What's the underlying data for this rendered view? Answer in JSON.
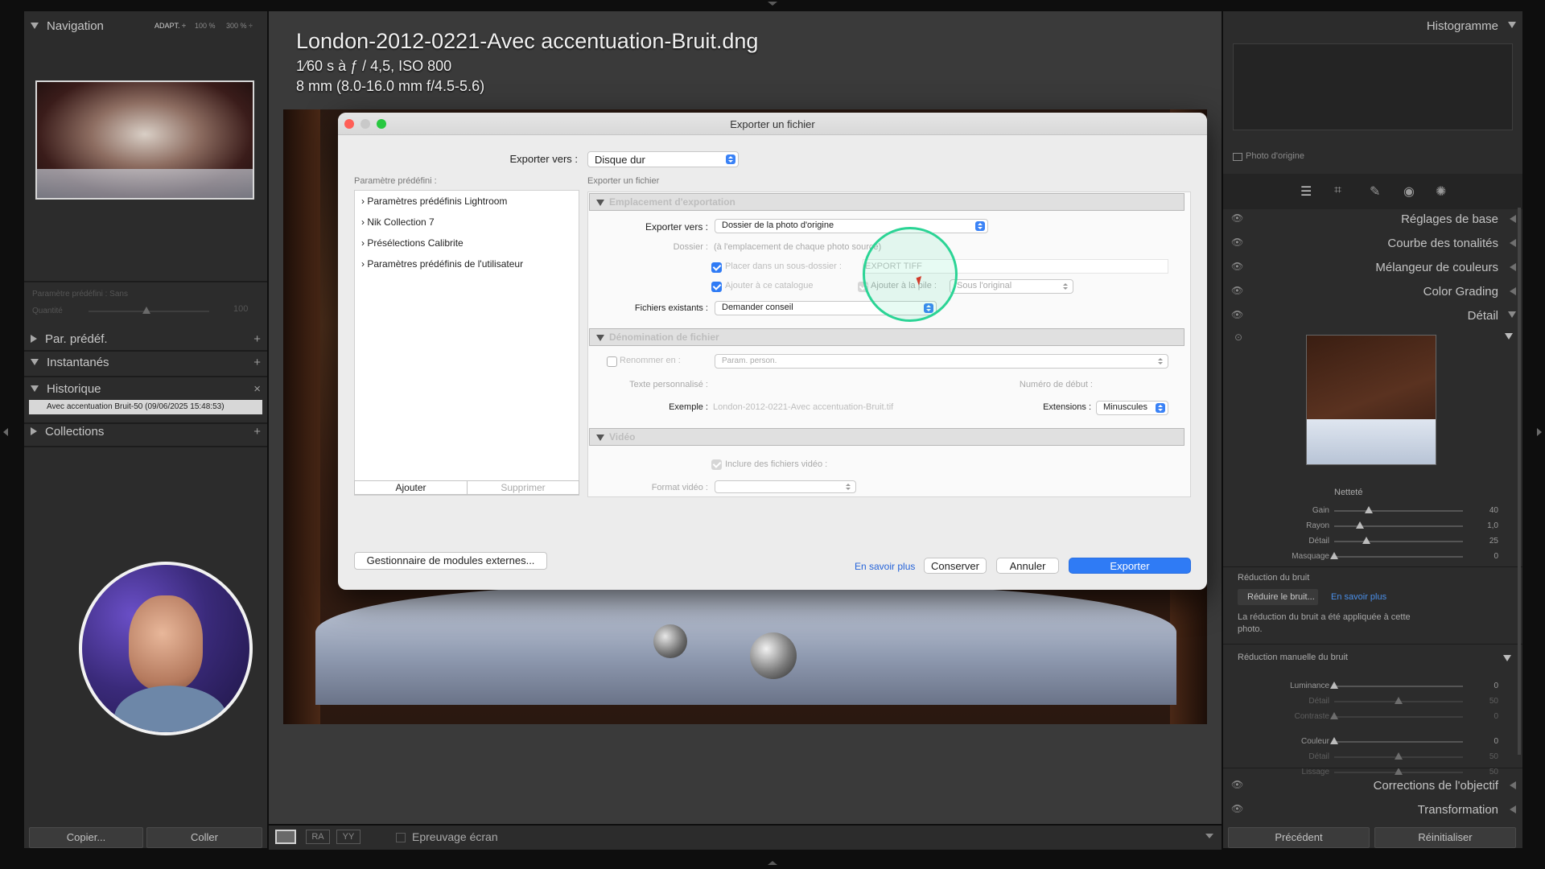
{
  "left": {
    "navigator": {
      "title": "Navigation",
      "zoom_options": [
        "ADAPT. ÷",
        "100 %",
        "300 % ÷"
      ]
    },
    "preset_area": {
      "preset_label": "Paramètre prédéfini : Sans",
      "quantity_label": "Quantité",
      "quantity_value": "100"
    },
    "sections": [
      {
        "label": "Par. prédéf."
      },
      {
        "label": "Instantanés"
      },
      {
        "label": "Historique"
      },
      {
        "label": "Collections"
      }
    ],
    "history_item": "Avec accentuation Bruit-50 (09/06/2025 15:48:53)",
    "copy_button": "Copier...",
    "paste_button": "Coller"
  },
  "photo_info": {
    "filename": "London-2012-0221-Avec accentuation-Bruit.dng",
    "exposure_fraction": "1⁄60",
    "exposure_rest": "s à ƒ / 4,5, ISO 800",
    "lens": "8 mm (8.0-16.0 mm f/4.5-5.6)"
  },
  "toolbar": {
    "view_modes": [
      "RA",
      "YY"
    ],
    "soft_proof_label": "Epreuvage écran"
  },
  "right": {
    "histogram_title": "Histogramme",
    "original_photo_label": "Photo d'origine",
    "panels": [
      "Réglages de base",
      "Courbe des tonalités",
      "Mélangeur de couleurs",
      "Color Grading",
      "Détail"
    ],
    "sharpening": {
      "title": "Netteté",
      "sliders": [
        {
          "name": "Gain",
          "value": "40",
          "pos": 0.27
        },
        {
          "name": "Rayon",
          "value": "1,0",
          "pos": 0.2
        },
        {
          "name": "Détail",
          "value": "25",
          "pos": 0.25
        },
        {
          "name": "Masquage",
          "value": "0",
          "pos": 0.0
        }
      ]
    },
    "noise_reduction": {
      "title": "Réduction du bruit",
      "button": "Réduire le bruit...",
      "link": "En savoir plus",
      "info": "La réduction du bruit a été appliquée à cette photo.",
      "manual_title": "Réduction manuelle du bruit",
      "sliders": [
        {
          "name": "Luminance",
          "value": "0",
          "pos": 0.0,
          "dim": false
        },
        {
          "name": "Détail",
          "value": "50",
          "pos": 0.5,
          "dim": true
        },
        {
          "name": "Contraste",
          "value": "0",
          "pos": 0.0,
          "dim": true
        },
        {
          "name": "Couleur",
          "value": "0",
          "pos": 0.0,
          "dim": false
        },
        {
          "name": "Détail",
          "value": "50",
          "pos": 0.5,
          "dim": true
        },
        {
          "name": "Lissage",
          "value": "50",
          "pos": 0.5,
          "dim": true
        }
      ]
    },
    "bottom_panels": [
      "Corrections de l'objectif",
      "Transformation"
    ],
    "previous_button": "Précédent",
    "reset_button": "Réinitialiser"
  },
  "dialog": {
    "title": "Exporter un fichier",
    "export_to_label": "Exporter vers :",
    "export_to_value": "Disque dur",
    "presets_label": "Paramètre prédéfini :",
    "presets": [
      "Paramètres prédéfinis Lightroom",
      "Nik Collection 7",
      "Présélections Calibrite",
      "Paramètres prédéfinis de l'utilisateur"
    ],
    "add_button": "Ajouter",
    "remove_button": "Supprimer",
    "subtitle": "Exporter un fichier",
    "location": {
      "title": "Emplacement d'exportation",
      "export_to_label": "Exporter vers :",
      "export_to_value": "Dossier de la photo d'origine",
      "folder_label": "Dossier :",
      "folder_value": "(à l'emplacement de chaque photo source)",
      "subfolder_label": "Placer dans un sous-dossier :",
      "subfolder_value": "EXPORT TIFF",
      "catalog_label": "Ajouter à ce catalogue",
      "stack_label": "Ajouter à la pile :",
      "stack_value": "Sous l'original",
      "existing_label": "Fichiers existants :",
      "existing_value": "Demander conseil"
    },
    "naming": {
      "title": "Dénomination de fichier",
      "rename_label": "Renommer en :",
      "rename_value": "Param. person.",
      "custom_text_label": "Texte personnalisé :",
      "start_number_label": "Numéro de début :",
      "example_label": "Exemple :",
      "example_value": "London-2012-0221-Avec accentuation-Bruit.tif",
      "extensions_label": "Extensions :",
      "extensions_value": "Minuscules"
    },
    "video": {
      "title": "Vidéo",
      "include_label": "Inclure des fichiers vidéo :",
      "format_label": "Format vidéo :"
    },
    "plugin_manager_button": "Gestionnaire de modules externes...",
    "learn_more_link": "En savoir plus",
    "keep_button": "Conserver",
    "cancel_button": "Annuler",
    "export_button": "Exporter"
  }
}
